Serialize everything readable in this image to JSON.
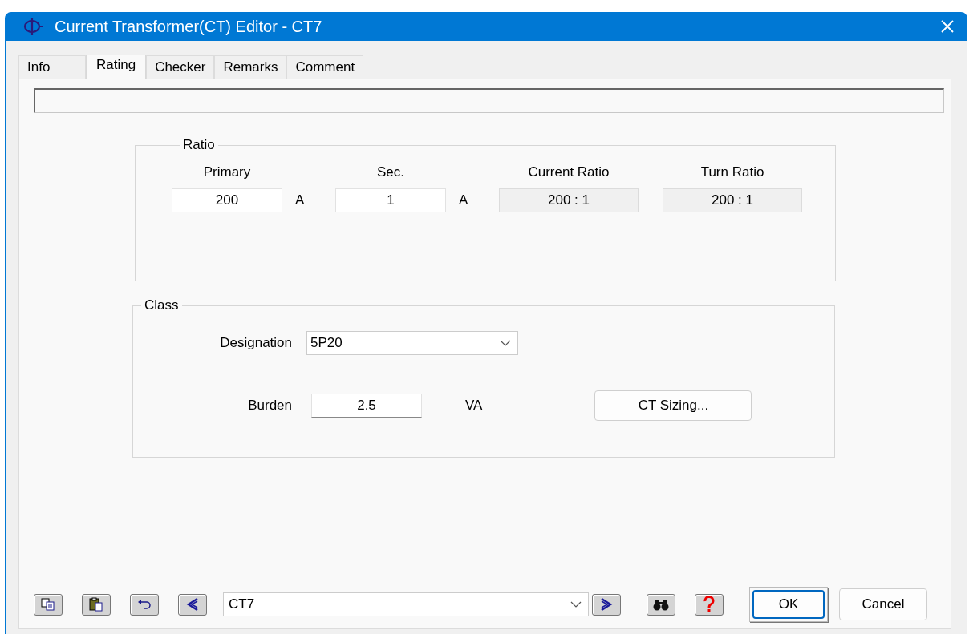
{
  "window": {
    "title": "Current Transformer(CT) Editor - CT7"
  },
  "tabs": [
    {
      "label": "Info",
      "selected": false
    },
    {
      "label": "Rating",
      "selected": true
    },
    {
      "label": "Checker",
      "selected": false
    },
    {
      "label": "Remarks",
      "selected": false
    },
    {
      "label": "Comment",
      "selected": false
    }
  ],
  "ratio": {
    "title": "Ratio",
    "columns": [
      {
        "label": "Primary",
        "value": "200",
        "unit": "A",
        "kind": "input"
      },
      {
        "label": "Sec.",
        "value": "1",
        "unit": "A",
        "kind": "input"
      },
      {
        "label": "Current Ratio",
        "value": "200 : 1",
        "kind": "readout"
      },
      {
        "label": "Turn Ratio",
        "value": "200 : 1",
        "kind": "readout"
      }
    ]
  },
  "class": {
    "title": "Class",
    "designation": {
      "label": "Designation",
      "value": "5P20"
    },
    "burden": {
      "label": "Burden",
      "value": "2.5",
      "unit": "VA"
    },
    "sizing_button": "CT Sizing..."
  },
  "toolbar": {
    "element": "CT7",
    "ok": {
      "label": "OK",
      "default": true
    },
    "cancel": {
      "label": "Cancel",
      "default": false
    }
  }
}
